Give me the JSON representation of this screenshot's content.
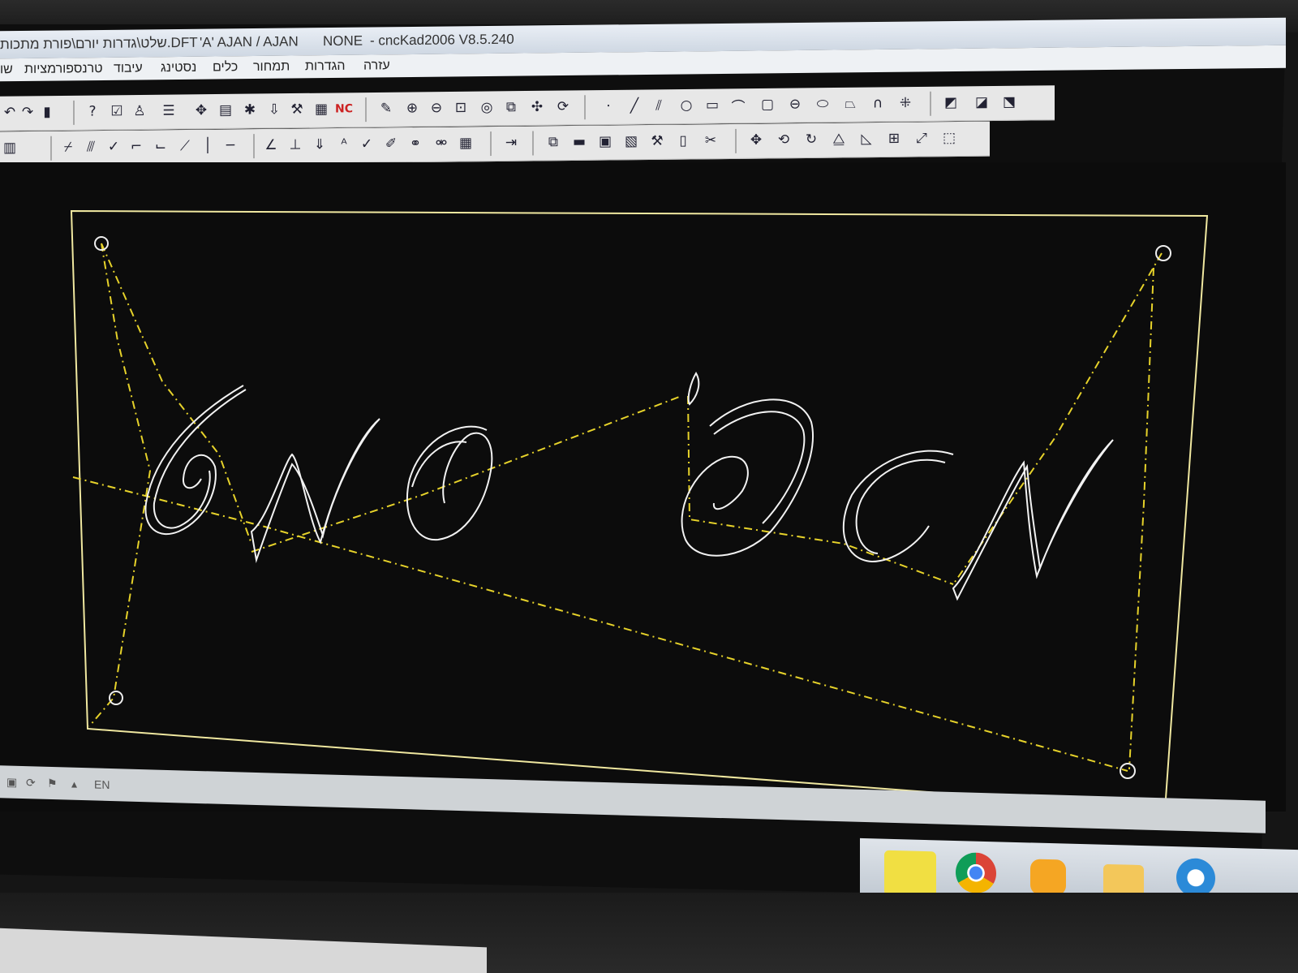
{
  "window": {
    "title_path": "שלט\\גדרות יורם\\פורת מתכות.DFT",
    "title_view": "'A'  AJAN / AJAN",
    "title_mode": "NONE",
    "title_app": "- cncKad2006 V8.5.240"
  },
  "menu": {
    "items": [
      "עזרה",
      "הגדרות",
      "תמחור",
      "כלים",
      "נסטינג",
      "עיבוד",
      "טרנספורמציות",
      "שו"
    ]
  },
  "toolbar": {
    "nc_label": "NC"
  },
  "status": {
    "language": "EN"
  },
  "drawing": {
    "background": "#0c0c0c",
    "border_color": "#f0e8a0",
    "path_color": "#f2f2f2",
    "toolpath_color": "#e6d22a"
  }
}
